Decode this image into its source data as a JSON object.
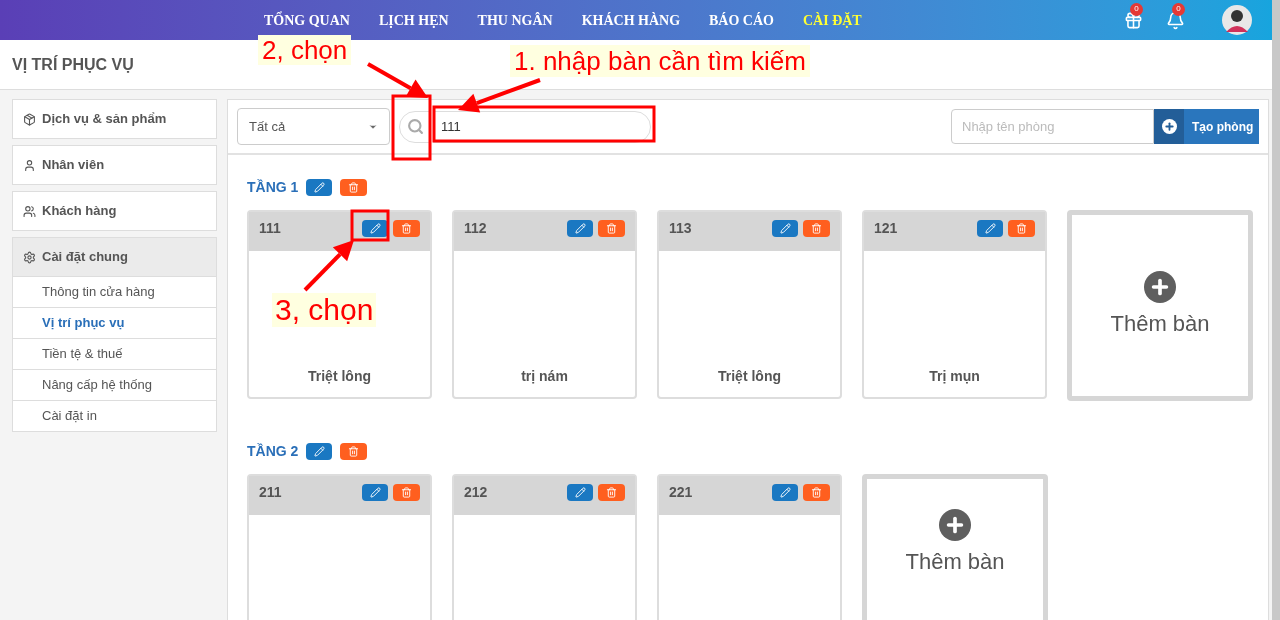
{
  "nav": {
    "items": [
      {
        "label": "TỔNG QUAN",
        "selected": false
      },
      {
        "label": "LỊCH HẸN",
        "selected": false
      },
      {
        "label": "THU NGÂN",
        "selected": false
      },
      {
        "label": "KHÁCH HÀNG",
        "selected": false
      },
      {
        "label": "BÁO CÁO",
        "selected": false
      },
      {
        "label": "CÀI ĐẶT",
        "selected": true
      }
    ],
    "gift_badge": "0",
    "bell_badge": "0"
  },
  "page_title": "VỊ TRÍ PHỤC VỤ",
  "sidebar": {
    "items": [
      {
        "kind": "box",
        "label": "Dịch vụ & sản phẩm",
        "expanded": false
      },
      {
        "kind": "user",
        "label": "Nhân viên",
        "expanded": false
      },
      {
        "kind": "users",
        "label": "Khách hàng",
        "expanded": false
      },
      {
        "kind": "gear",
        "label": "Cài đặt chung",
        "expanded": true,
        "children": [
          {
            "label": "Thông tin cửa hàng",
            "selected": false
          },
          {
            "label": "Vị trí phục vụ",
            "selected": true
          },
          {
            "label": "Tiền tệ & thuế",
            "selected": false
          },
          {
            "label": "Nâng cấp hệ thống",
            "selected": false
          },
          {
            "label": "Cài đặt in",
            "selected": false
          }
        ]
      }
    ]
  },
  "toolbar": {
    "filter": "Tất cả",
    "search_value": "111",
    "room_placeholder": "Nhập tên phòng",
    "create_button": "Tạo phòng"
  },
  "floors": [
    {
      "title": "TẦNG 1",
      "tables": [
        {
          "number": "111",
          "service": "Triệt lông"
        },
        {
          "number": "112",
          "service": "trị nám"
        },
        {
          "number": "113",
          "service": "Triệt lông"
        },
        {
          "number": "121",
          "service": "Trị mụn"
        }
      ],
      "add_label": "Thêm bàn"
    },
    {
      "title": "TẦNG 2",
      "tables": [
        {
          "number": "211"
        },
        {
          "number": "212"
        },
        {
          "number": "221"
        }
      ],
      "add_label": "Thêm bàn"
    }
  ],
  "annotations": [
    "2, chọn",
    "1. nhập bàn cần tìm kiếm",
    "3, chọn"
  ]
}
